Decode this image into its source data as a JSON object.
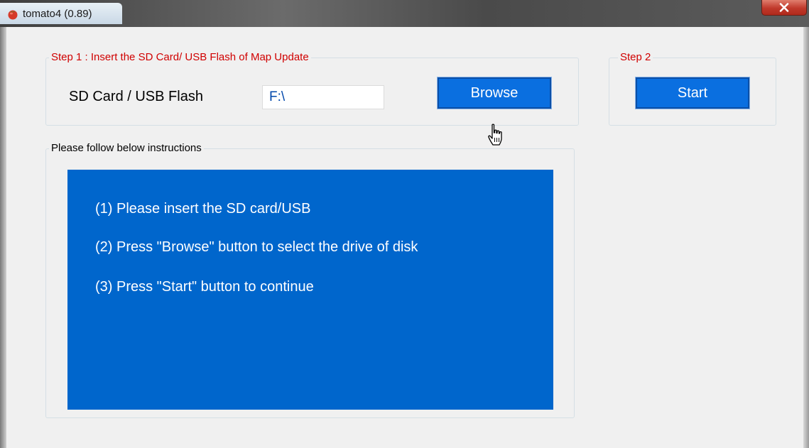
{
  "window": {
    "title": "tomato4 (0.89)",
    "icon": "tomato-icon"
  },
  "step1": {
    "legend": "Step 1 : Insert the SD Card/ USB Flash of Map Update",
    "label": "SD Card / USB Flash",
    "path_value": "F:\\",
    "browse_label": "Browse"
  },
  "step2": {
    "legend": "Step 2",
    "start_label": "Start"
  },
  "instructions": {
    "legend": "Please follow below instructions",
    "lines": [
      "(1) Please insert the SD card/USB",
      "(2) Press \"Browse\" button to select the drive of disk",
      "(3) Press \"Start\" button to continue"
    ]
  },
  "colors": {
    "accent": "#0a6fe0",
    "panel": "#0066cc",
    "legend_red": "#d00000",
    "path_text": "#0047ab"
  }
}
